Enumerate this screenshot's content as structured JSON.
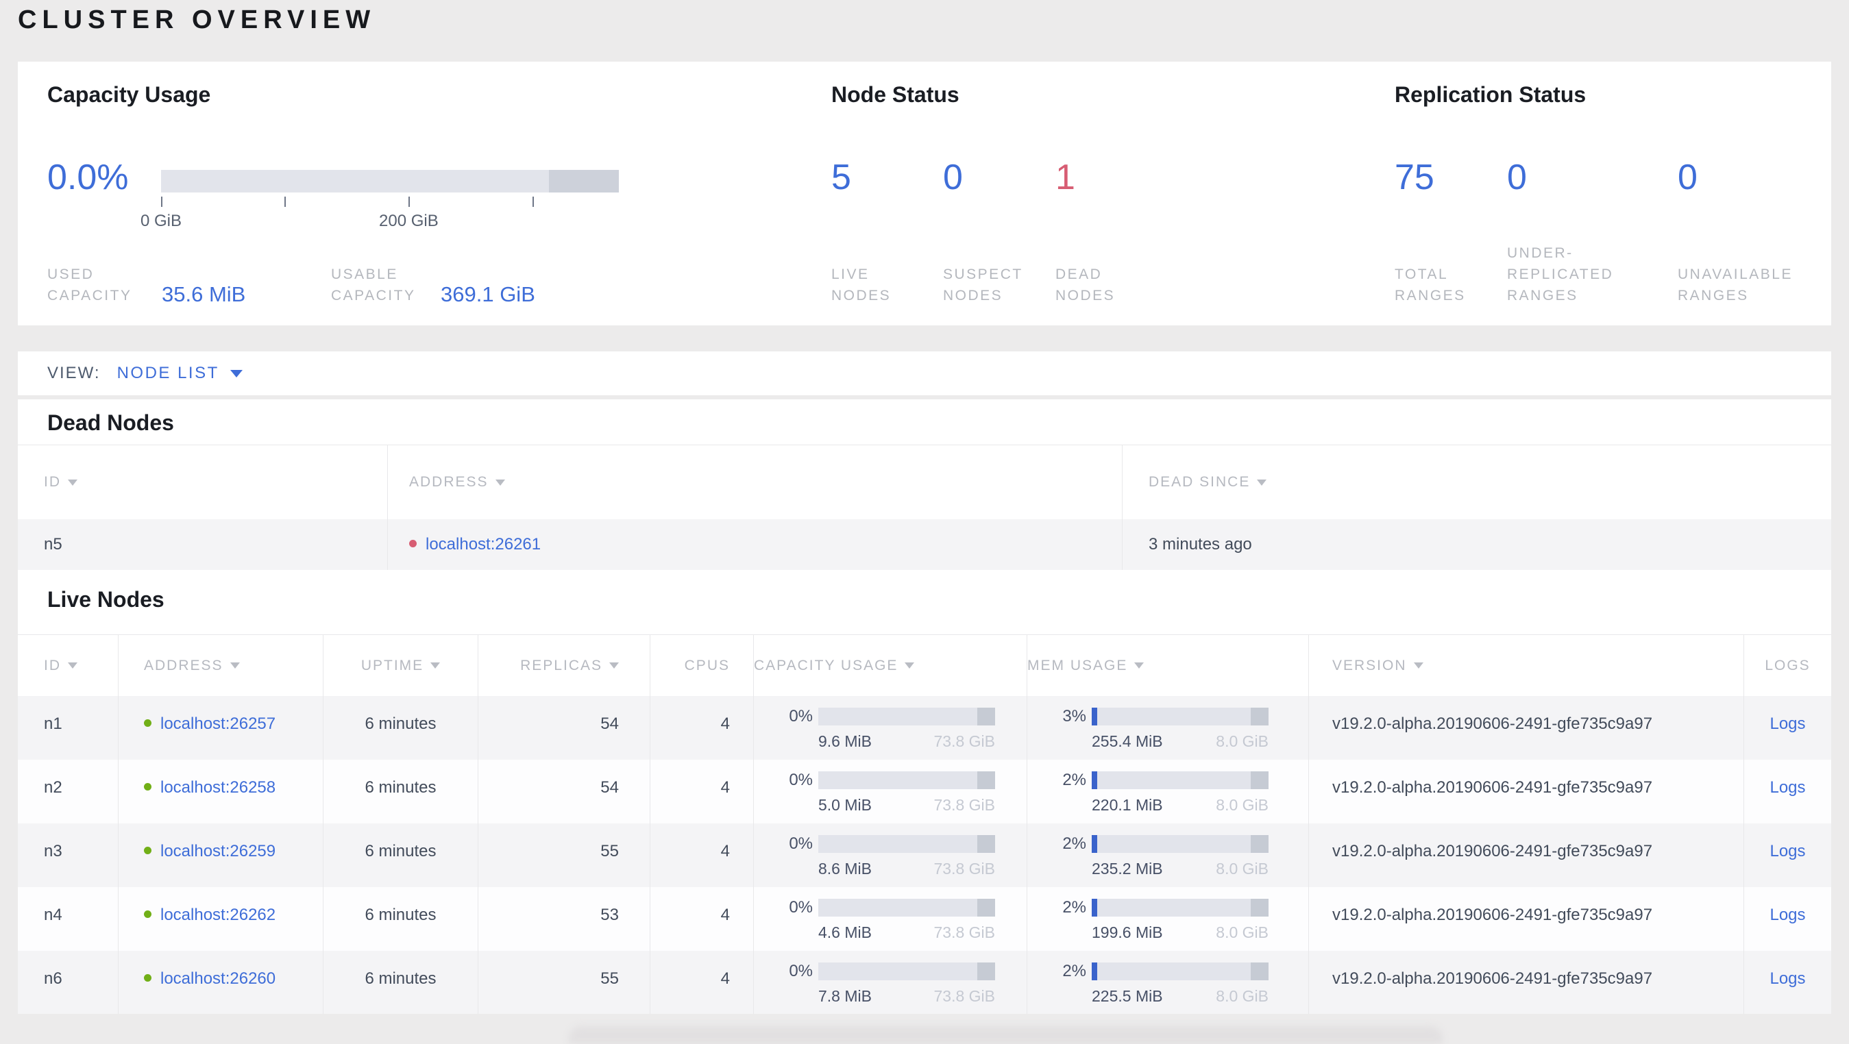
{
  "page": {
    "title": "CLUSTER OVERVIEW"
  },
  "colors": {
    "accent_blue": "#3e6dd8",
    "danger_red": "#d75d73",
    "live_green": "#71af17",
    "bar_track": "#e2e4eb",
    "bar_reserved": "#c6cbd4",
    "bar_fill_blue": "#3a63cb"
  },
  "summary": {
    "capacity": {
      "heading": "Capacity Usage",
      "percent": "0.0%",
      "axis_ticks": [
        {
          "pct": 0,
          "label": "0 GiB"
        },
        {
          "pct": 27.0,
          "label": ""
        },
        {
          "pct": 54.1,
          "label": "200 GiB"
        },
        {
          "pct": 81.1,
          "label": ""
        }
      ],
      "reserved_start_pct": 84.7,
      "stats": [
        {
          "label": "USED\nCAPACITY",
          "value": "35.6 MiB"
        },
        {
          "label": "USABLE\nCAPACITY",
          "value": "369.1 GiB"
        }
      ]
    },
    "node_status": {
      "heading": "Node Status",
      "stats": [
        {
          "value": "5",
          "label": "LIVE\nNODES",
          "color": "blue"
        },
        {
          "value": "0",
          "label": "SUSPECT\nNODES",
          "color": "blue"
        },
        {
          "value": "1",
          "label": "DEAD\nNODES",
          "color": "red"
        }
      ]
    },
    "replication": {
      "heading": "Replication Status",
      "stats": [
        {
          "value": "75",
          "label": "TOTAL\nRANGES",
          "color": "blue"
        },
        {
          "value": "0",
          "label": "UNDER-\nREPLICATED\nRANGES",
          "color": "blue"
        },
        {
          "value": "0",
          "label": "UNAVAILABLE\nRANGES",
          "color": "blue"
        }
      ]
    }
  },
  "view_bar": {
    "label": "VIEW:",
    "selected": "NODE LIST"
  },
  "dead_nodes": {
    "heading": "Dead Nodes",
    "columns": [
      {
        "label": "ID",
        "sortable": true
      },
      {
        "label": "ADDRESS",
        "sortable": true
      },
      {
        "label": "DEAD SINCE",
        "sortable": true
      }
    ],
    "rows": [
      {
        "id": "n5",
        "address": "localhost:26261",
        "dead_since": "3 minutes ago"
      }
    ]
  },
  "live_nodes": {
    "heading": "Live Nodes",
    "columns": [
      {
        "label": "ID",
        "sortable": true
      },
      {
        "label": "ADDRESS",
        "sortable": true
      },
      {
        "label": "UPTIME",
        "sortable": true
      },
      {
        "label": "REPLICAS",
        "sortable": true
      },
      {
        "label": "CPUS",
        "sortable": false
      },
      {
        "label": "CAPACITY USAGE",
        "sortable": true
      },
      {
        "label": "MEM USAGE",
        "sortable": true
      },
      {
        "label": "VERSION",
        "sortable": true
      },
      {
        "label": "LOGS",
        "sortable": false
      }
    ],
    "rows": [
      {
        "id": "n1",
        "address": "localhost:26257",
        "uptime": "6 minutes",
        "replicas": "54",
        "cpus": "4",
        "capacity": {
          "pct": "0%",
          "fill_pct": 0,
          "used": "9.6 MiB",
          "total": "73.8 GiB"
        },
        "mem": {
          "pct": "3%",
          "fill_pct": 3,
          "used": "255.4 MiB",
          "total": "8.0 GiB"
        },
        "version": "v19.2.0-alpha.20190606-2491-gfe735c9a97",
        "logs": "Logs"
      },
      {
        "id": "n2",
        "address": "localhost:26258",
        "uptime": "6 minutes",
        "replicas": "54",
        "cpus": "4",
        "capacity": {
          "pct": "0%",
          "fill_pct": 0,
          "used": "5.0 MiB",
          "total": "73.8 GiB"
        },
        "mem": {
          "pct": "2%",
          "fill_pct": 2,
          "used": "220.1 MiB",
          "total": "8.0 GiB"
        },
        "version": "v19.2.0-alpha.20190606-2491-gfe735c9a97",
        "logs": "Logs"
      },
      {
        "id": "n3",
        "address": "localhost:26259",
        "uptime": "6 minutes",
        "replicas": "55",
        "cpus": "4",
        "capacity": {
          "pct": "0%",
          "fill_pct": 0,
          "used": "8.6 MiB",
          "total": "73.8 GiB"
        },
        "mem": {
          "pct": "2%",
          "fill_pct": 2,
          "used": "235.2 MiB",
          "total": "8.0 GiB"
        },
        "version": "v19.2.0-alpha.20190606-2491-gfe735c9a97",
        "logs": "Logs"
      },
      {
        "id": "n4",
        "address": "localhost:26262",
        "uptime": "6 minutes",
        "replicas": "53",
        "cpus": "4",
        "capacity": {
          "pct": "0%",
          "fill_pct": 0,
          "used": "4.6 MiB",
          "total": "73.8 GiB"
        },
        "mem": {
          "pct": "2%",
          "fill_pct": 2,
          "used": "199.6 MiB",
          "total": "8.0 GiB"
        },
        "version": "v19.2.0-alpha.20190606-2491-gfe735c9a97",
        "logs": "Logs"
      },
      {
        "id": "n6",
        "address": "localhost:26260",
        "uptime": "6 minutes",
        "replicas": "55",
        "cpus": "4",
        "capacity": {
          "pct": "0%",
          "fill_pct": 0,
          "used": "7.8 MiB",
          "total": "73.8 GiB"
        },
        "mem": {
          "pct": "2%",
          "fill_pct": 2,
          "used": "225.5 MiB",
          "total": "8.0 GiB"
        },
        "version": "v19.2.0-alpha.20190606-2491-gfe735c9a97",
        "logs": "Logs"
      }
    ]
  }
}
